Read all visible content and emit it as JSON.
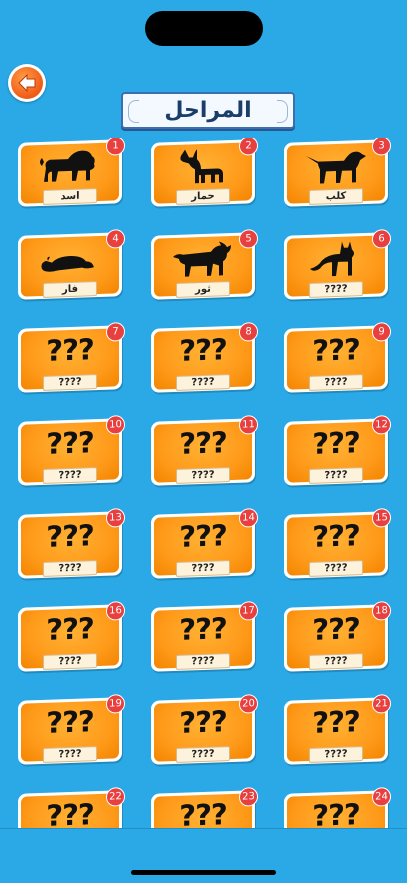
{
  "header": {
    "title": "المراحل",
    "back_icon": "back-arrow-icon"
  },
  "theme": {
    "background": "#2aa9e6",
    "card_orange": "#ff9a1a",
    "badge_red": "#e83f3f"
  },
  "levels": [
    {
      "number": "1",
      "name": "اسد",
      "icon": "lion-icon",
      "unlocked": true
    },
    {
      "number": "2",
      "name": "حمار",
      "icon": "donkey-icon",
      "unlocked": true
    },
    {
      "number": "3",
      "name": "كلب",
      "icon": "dog-icon",
      "unlocked": true
    },
    {
      "number": "4",
      "name": "فار",
      "icon": "mouse-icon",
      "unlocked": true
    },
    {
      "number": "5",
      "name": "ثور",
      "icon": "bull-icon",
      "unlocked": true
    },
    {
      "number": "6",
      "name": "????",
      "icon": "fox-icon",
      "unlocked": true
    },
    {
      "number": "7",
      "name": "????",
      "mystery": "???",
      "unlocked": false
    },
    {
      "number": "8",
      "name": "????",
      "mystery": "???",
      "unlocked": false
    },
    {
      "number": "9",
      "name": "????",
      "mystery": "???",
      "unlocked": false
    },
    {
      "number": "10",
      "name": "????",
      "mystery": "???",
      "unlocked": false
    },
    {
      "number": "11",
      "name": "????",
      "mystery": "???",
      "unlocked": false
    },
    {
      "number": "12",
      "name": "????",
      "mystery": "???",
      "unlocked": false
    },
    {
      "number": "13",
      "name": "????",
      "mystery": "???",
      "unlocked": false
    },
    {
      "number": "14",
      "name": "????",
      "mystery": "???",
      "unlocked": false
    },
    {
      "number": "15",
      "name": "????",
      "mystery": "???",
      "unlocked": false
    },
    {
      "number": "16",
      "name": "????",
      "mystery": "???",
      "unlocked": false
    },
    {
      "number": "17",
      "name": "????",
      "mystery": "???",
      "unlocked": false
    },
    {
      "number": "18",
      "name": "????",
      "mystery": "???",
      "unlocked": false
    },
    {
      "number": "19",
      "name": "????",
      "mystery": "???",
      "unlocked": false
    },
    {
      "number": "20",
      "name": "????",
      "mystery": "???",
      "unlocked": false
    },
    {
      "number": "21",
      "name": "????",
      "mystery": "???",
      "unlocked": false
    },
    {
      "number": "22",
      "name": "????",
      "mystery": "???",
      "unlocked": false
    },
    {
      "number": "23",
      "name": "????",
      "mystery": "???",
      "unlocked": false
    },
    {
      "number": "24",
      "name": "????",
      "mystery": "???",
      "unlocked": false
    }
  ]
}
